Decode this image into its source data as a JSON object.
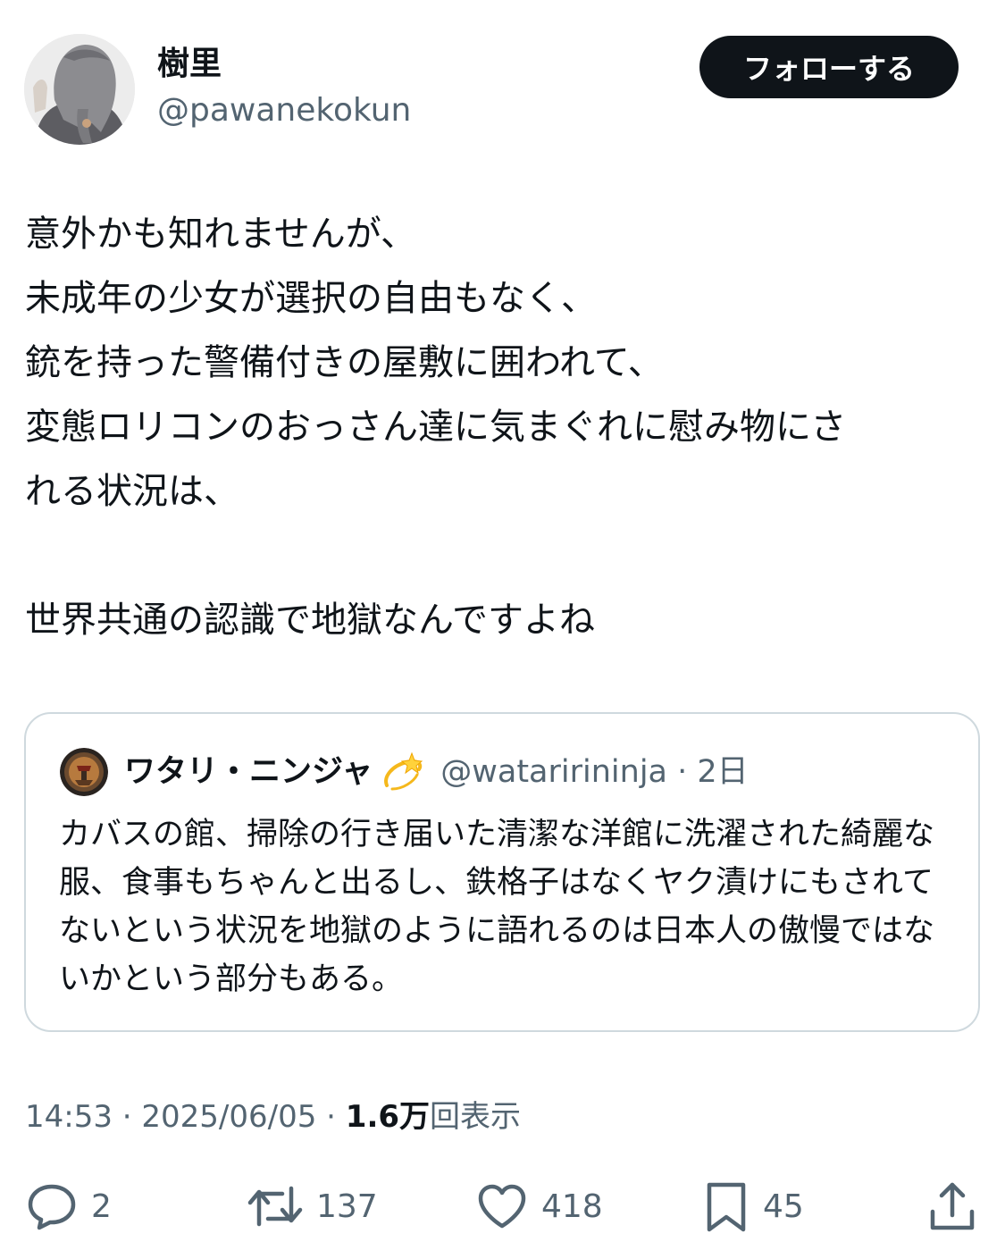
{
  "author": {
    "display_name": "樹里",
    "handle": "@pawanekokun"
  },
  "follow_button_label": "フォローする",
  "tweet_text": "意外かも知れませんが、\n未成年の少女が選択の自由もなく、\n銃を持った警備付きの屋敷に囲われて、\n変態ロリコンのおっさん達に気まぐれに慰み物にさ\nれる状況は、\n\n世界共通の認識で地獄なんですよね",
  "quote": {
    "display_name": "ワタリ・ニンジャ",
    "emoji_icon": "dizzy-star-icon",
    "handle_time": "@wataririninja · 2日",
    "text": "カバスの館、掃除の行き届いた清潔な洋館に洗濯された綺麗な服、食事もちゃんと出るし、鉄格子はなくヤク漬けにもされてないという状況を地獄のように語れるのは日本人の傲慢ではないかという部分もある。"
  },
  "meta": {
    "time_date": "14:53 · 2025/06/05 · ",
    "views_count": "1.6万",
    "views_label": "回表示"
  },
  "actions": {
    "replies": "2",
    "reposts": "137",
    "likes": "418",
    "bookmarks": "45"
  },
  "icons": {
    "reply": "reply-bubble-icon",
    "repost": "repost-arrows-icon",
    "like": "heart-icon",
    "bookmark": "bookmark-icon",
    "share": "share-icon"
  },
  "colors": {
    "text_primary": "#0f1419",
    "text_secondary": "#536471",
    "border": "#cfd9de",
    "follow_bg": "#0f1419"
  }
}
